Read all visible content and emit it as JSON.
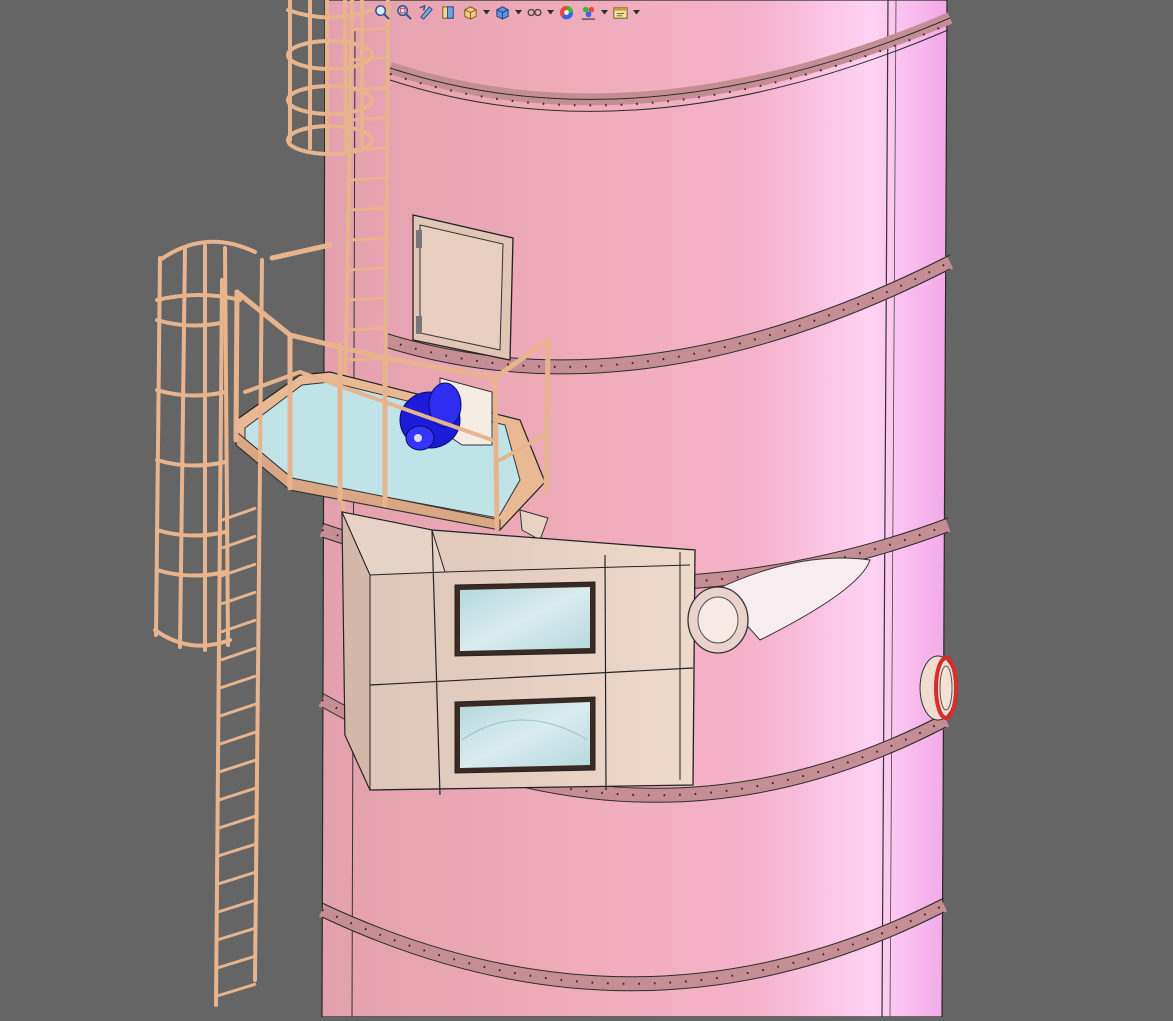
{
  "view": {
    "background": "#656565",
    "tower_color": "#e8a7b7",
    "tower_highlight": "#ffd0f4",
    "steel_color": "#e9b994",
    "glass_color": "#bfe3e6",
    "motor_color": "#1b1bd8",
    "flange_accent": "#d62c2c"
  },
  "toolbar": {
    "items": [
      {
        "icon": "zoom-to-fit-icon",
        "dropdown": false
      },
      {
        "icon": "zoom-area-icon",
        "dropdown": false
      },
      {
        "icon": "previous-view-icon",
        "dropdown": false
      },
      {
        "icon": "section-view-icon",
        "dropdown": false
      },
      {
        "icon": "view-orientation-icon",
        "dropdown": true
      },
      {
        "icon": "display-style-icon",
        "dropdown": true
      },
      {
        "icon": "hide-show-items-icon",
        "dropdown": true
      },
      {
        "icon": "edit-appearance-icon",
        "dropdown": false
      },
      {
        "icon": "apply-scene-icon",
        "dropdown": true
      },
      {
        "icon": "view-settings-icon",
        "dropdown": true
      }
    ]
  }
}
